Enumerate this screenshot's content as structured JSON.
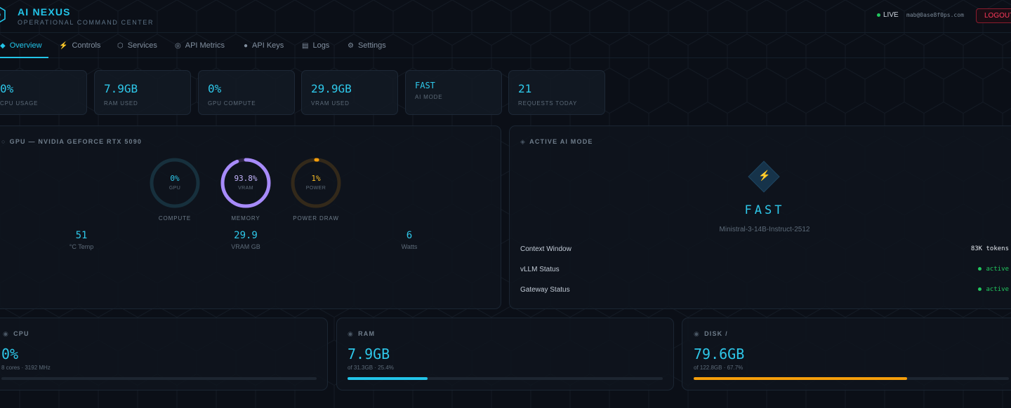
{
  "header": {
    "title": "AI NEXUS",
    "subtitle": "OPERATIONAL COMMAND CENTER",
    "live_label": "LIVE",
    "user_email": "mab@0ase8f0ps.com",
    "logout_label": "LOGOUT"
  },
  "nav": {
    "tabs": [
      {
        "label": "Overview",
        "icon": "diamond-icon",
        "active": true
      },
      {
        "label": "Controls",
        "icon": "bolt-icon"
      },
      {
        "label": "Services",
        "icon": "hexagon-icon"
      },
      {
        "label": "API Metrics",
        "icon": "gauge-icon"
      },
      {
        "label": "API Keys",
        "icon": "key-icon"
      },
      {
        "label": "Logs",
        "icon": "list-icon"
      },
      {
        "label": "Settings",
        "icon": "gear-icon"
      }
    ]
  },
  "stats": [
    {
      "value": "0%",
      "label": "CPU USAGE"
    },
    {
      "value": "7.9GB",
      "label": "RAM USED"
    },
    {
      "value": "0%",
      "label": "GPU COMPUTE"
    },
    {
      "value": "29.9GB",
      "label": "VRAM USED"
    },
    {
      "value": "FAST",
      "label": "AI MODE"
    },
    {
      "value": "21",
      "label": "REQUESTS TODAY"
    }
  ],
  "gpu_panel": {
    "title": "GPU — NVIDIA GEFORCE RTX 5090",
    "gauges": [
      {
        "value": "0%",
        "sub": "GPU",
        "caption": "COMPUTE",
        "fraction": 0.0,
        "color": "#22c4e8"
      },
      {
        "value": "93.8%",
        "sub": "VRAM",
        "caption": "MEMORY",
        "fraction": 0.938,
        "color": "#a78bfa"
      },
      {
        "value": "1%",
        "sub": "POWER",
        "caption": "POWER DRAW",
        "fraction": 0.01,
        "color": "#f59e0b"
      }
    ],
    "metrics": [
      {
        "value": "51",
        "label": "°C Temp"
      },
      {
        "value": "29.9",
        "label": "VRAM GB"
      },
      {
        "value": "6",
        "label": "Watts"
      }
    ]
  },
  "ai_mode_panel": {
    "title": "ACTIVE AI MODE",
    "mode": "FAST",
    "model": "Ministral-3-14B-Instruct-2512",
    "rows": [
      {
        "label": "Context Window",
        "value": "83K tokens"
      },
      {
        "label": "vLLM Status",
        "value": "active"
      },
      {
        "label": "Gateway Status",
        "value": "active"
      }
    ]
  },
  "resources": [
    {
      "title": "CPU",
      "value": "0%",
      "detail": "8 cores · 3192 MHz",
      "fraction": 0.0,
      "color": "#22c4e8"
    },
    {
      "title": "RAM",
      "value": "7.9GB",
      "detail": "of 31.3GB · 25.4%",
      "fraction": 0.254,
      "color": "#22c4e8"
    },
    {
      "title": "DISK /",
      "value": "79.6GB",
      "detail": "of 122.8GB · 67.7%",
      "fraction": 0.677,
      "color": "#f59e0b"
    }
  ]
}
